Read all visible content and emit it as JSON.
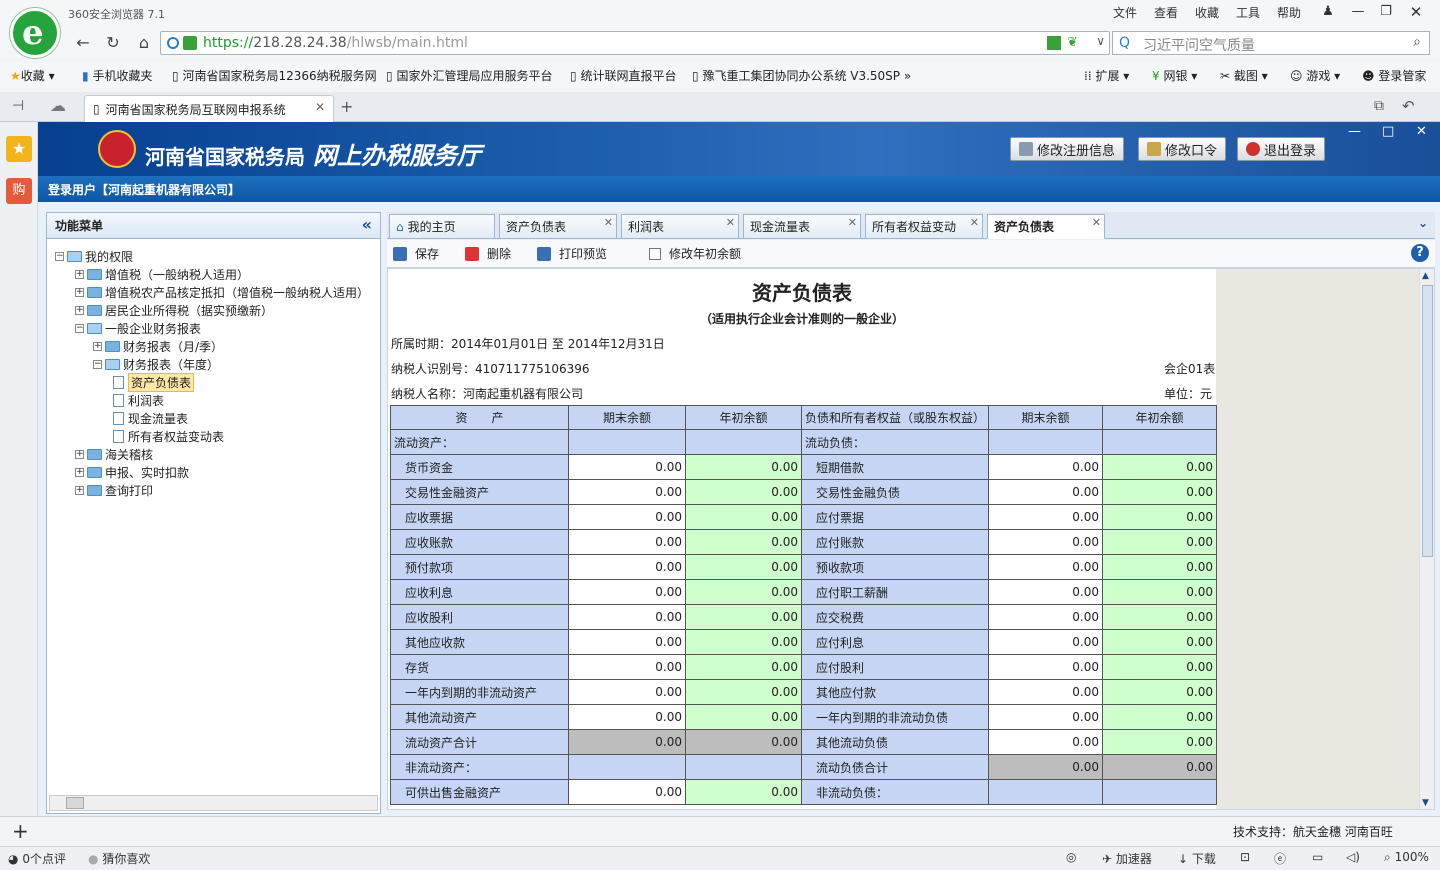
{
  "browser": {
    "app_title": "360安全浏览器 7.1",
    "menu": [
      "文件",
      "查看",
      "收藏",
      "工具",
      "帮助"
    ],
    "url_scheme": "https://",
    "url_host": "218.28.24.38",
    "url_path": "/hlwsb/main.html",
    "search_placeholder": "习近平问空气质量",
    "bookmarks": [
      "收藏",
      "手机收藏夹",
      "河南省国家税务局12366纳税服务网",
      "国家外汇管理局应用服务平台",
      "统计联网直报平台",
      "豫飞重工集团协同办公系统 V3.50SP"
    ],
    "bookmark_right": [
      "扩展",
      "网银",
      "截图",
      "游戏",
      "登录管家"
    ],
    "tab_title": "河南省国家税务局互联网申报系统",
    "sidebar_buy": "购"
  },
  "site": {
    "name": "河南省国家税务局",
    "subtitle": "网上办税服务厅",
    "buttons": [
      "修改注册信息",
      "修改口令",
      "退出登录"
    ],
    "login_user": "登录用户【河南起重机器有限公司】"
  },
  "menu": {
    "title": "功能菜单",
    "collapse": "«",
    "tree": [
      {
        "label": "我的权限",
        "level": 0,
        "type": "folder-open"
      },
      {
        "label": "增值税（一般纳税人适用）",
        "level": 1,
        "type": "folder"
      },
      {
        "label": "增值税农产品核定抵扣（增值税一般纳税人适用）",
        "level": 1,
        "type": "folder"
      },
      {
        "label": "居民企业所得税（据实预缴新）",
        "level": 1,
        "type": "folder"
      },
      {
        "label": "一般企业财务报表",
        "level": 1,
        "type": "folder-open"
      },
      {
        "label": "财务报表（月/季）",
        "level": 2,
        "type": "folder"
      },
      {
        "label": "财务报表（年度）",
        "level": 2,
        "type": "folder-open"
      },
      {
        "label": "资产负债表",
        "level": 3,
        "type": "doc-selected"
      },
      {
        "label": "利润表",
        "level": 3,
        "type": "doc"
      },
      {
        "label": "现金流量表",
        "level": 3,
        "type": "doc"
      },
      {
        "label": "所有者权益变动表",
        "level": 3,
        "type": "doc"
      },
      {
        "label": "海关稽核",
        "level": 1,
        "type": "folder"
      },
      {
        "label": "申报、实时扣款",
        "level": 1,
        "type": "folder"
      },
      {
        "label": "查询打印",
        "level": 1,
        "type": "folder"
      }
    ]
  },
  "tabs": [
    {
      "label": "我的主页",
      "closable": false
    },
    {
      "label": "资产负债表",
      "closable": true
    },
    {
      "label": "利润表",
      "closable": true
    },
    {
      "label": "现金流量表",
      "closable": true
    },
    {
      "label": "所有者权益变动",
      "closable": true
    },
    {
      "label": "资产负债表",
      "closable": true,
      "active": true
    }
  ],
  "toolbar": {
    "save": "保存",
    "delete": "删除",
    "print": "打印预览",
    "modify": "修改年初余额"
  },
  "report": {
    "title": "资产负债表",
    "subtitle": "（适用执行企业会计准则的一般企业）",
    "period": "所属时期：2014年01月01日 至 2014年12月31日",
    "taxid": "纳税人识别号：410711775106396",
    "form_no": "会企01表",
    "taxpayer": "纳税人名称：河南起重机器有限公司",
    "unit": "单位：元",
    "headers": [
      "资　　产",
      "期末余额",
      "年初余额",
      "负债和所有者权益（或股东权益）",
      "期末余额",
      "年初余额"
    ],
    "rows": [
      {
        "left": "流动资产：",
        "lsec": true,
        "right": "流动负债：",
        "rsec": true
      },
      {
        "left": "货币资金",
        "l1": "0.00",
        "l2": "0.00",
        "right": "短期借款",
        "r1": "0.00",
        "r2": "0.00"
      },
      {
        "left": "交易性金融资产",
        "l1": "0.00",
        "l2": "0.00",
        "right": "交易性金融负债",
        "r1": "0.00",
        "r2": "0.00"
      },
      {
        "left": "应收票据",
        "l1": "0.00",
        "l2": "0.00",
        "right": "应付票据",
        "r1": "0.00",
        "r2": "0.00"
      },
      {
        "left": "应收账款",
        "l1": "0.00",
        "l2": "0.00",
        "right": "应付账款",
        "r1": "0.00",
        "r2": "0.00"
      },
      {
        "left": "预付款项",
        "l1": "0.00",
        "l2": "0.00",
        "right": "预收款项",
        "r1": "0.00",
        "r2": "0.00"
      },
      {
        "left": "应收利息",
        "l1": "0.00",
        "l2": "0.00",
        "right": "应付职工薪酬",
        "r1": "0.00",
        "r2": "0.00"
      },
      {
        "left": "应收股利",
        "l1": "0.00",
        "l2": "0.00",
        "right": "应交税费",
        "r1": "0.00",
        "r2": "0.00"
      },
      {
        "left": "其他应收款",
        "l1": "0.00",
        "l2": "0.00",
        "right": "应付利息",
        "r1": "0.00",
        "r2": "0.00"
      },
      {
        "left": "存货",
        "l1": "0.00",
        "l2": "0.00",
        "right": "应付股利",
        "r1": "0.00",
        "r2": "0.00"
      },
      {
        "left": "一年内到期的非流动资产",
        "l1": "0.00",
        "l2": "0.00",
        "right": "其他应付款",
        "r1": "0.00",
        "r2": "0.00"
      },
      {
        "left": "其他流动资产",
        "l1": "0.00",
        "l2": "0.00",
        "right": "一年内到期的非流动负债",
        "r1": "0.00",
        "r2": "0.00"
      },
      {
        "left": "流动资产合计",
        "l1": "0.00",
        "l2": "0.00",
        "lgray": true,
        "right": "其他流动负债",
        "r1": "0.00",
        "r2": "0.00"
      },
      {
        "left": "非流动资产：",
        "lsec2": true,
        "right": "流动负债合计",
        "r1": "0.00",
        "r2": "0.00",
        "rgray": true
      },
      {
        "left": "可供出售金融资产",
        "l1": "0.00",
        "l2": "0.00",
        "right": "非流动负债：",
        "rsec2": true
      }
    ]
  },
  "footer": {
    "support": "技术支持：航天金穗 河南百旺",
    "add": "+"
  },
  "status": {
    "comments": "0个点评",
    "guess": "猜你喜欢",
    "accelerator": "加速器",
    "download": "下载",
    "zoom": "100%"
  }
}
